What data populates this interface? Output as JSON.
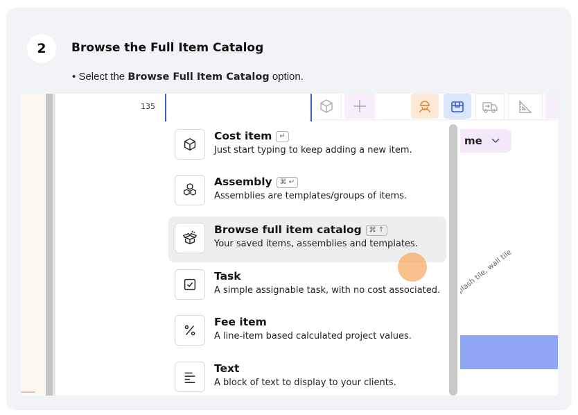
{
  "step": {
    "number": "2",
    "title": "Browse the Full Item Catalog"
  },
  "instruction": {
    "bullet": "•",
    "prefix": "Select the ",
    "highlight": "Browse Full Item Catalog",
    "suffix": " option."
  },
  "screenshot": {
    "row_number": "135",
    "toolbar_icons": [
      "cube-icon",
      "plus-icon",
      "worker-icon",
      "box-icon",
      "truck-icon",
      "ruler-icon"
    ],
    "column_pill": {
      "label": "me",
      "icon": "chevron-down-icon"
    },
    "diagonal_text": "ksplash tile, wall tile",
    "menu": {
      "items": [
        {
          "title": "Cost item",
          "shortcut": "↵",
          "description": "Just start typing to keep adding a new item.",
          "icon": "cube-icon",
          "highlighted": false
        },
        {
          "title": "Assembly",
          "shortcut": "⌘ ↵",
          "description": "Assemblies are templates/groups of items.",
          "icon": "cubes-icon",
          "highlighted": false
        },
        {
          "title": "Browse full item catalog",
          "shortcut": "⌘ ↑",
          "description": "Your saved items, assemblies and templates.",
          "icon": "open-box-icon",
          "highlighted": true
        },
        {
          "title": "Task",
          "shortcut": "",
          "description": "A simple assignable task, with no cost associated.",
          "icon": "checkbox-icon",
          "highlighted": false
        },
        {
          "title": "Fee item",
          "shortcut": "",
          "description": "A line-item based calculated project values.",
          "icon": "percent-icon",
          "highlighted": false
        },
        {
          "title": "Text",
          "shortcut": "",
          "description": "A block of text to display to your clients.",
          "icon": "text-align-icon",
          "highlighted": false
        }
      ]
    },
    "colors": {
      "accent": "#3b5bc9",
      "highlight_row": "#eeeef0",
      "cursor": "#f69c46",
      "blue_bar": "#8fa6f2"
    }
  }
}
